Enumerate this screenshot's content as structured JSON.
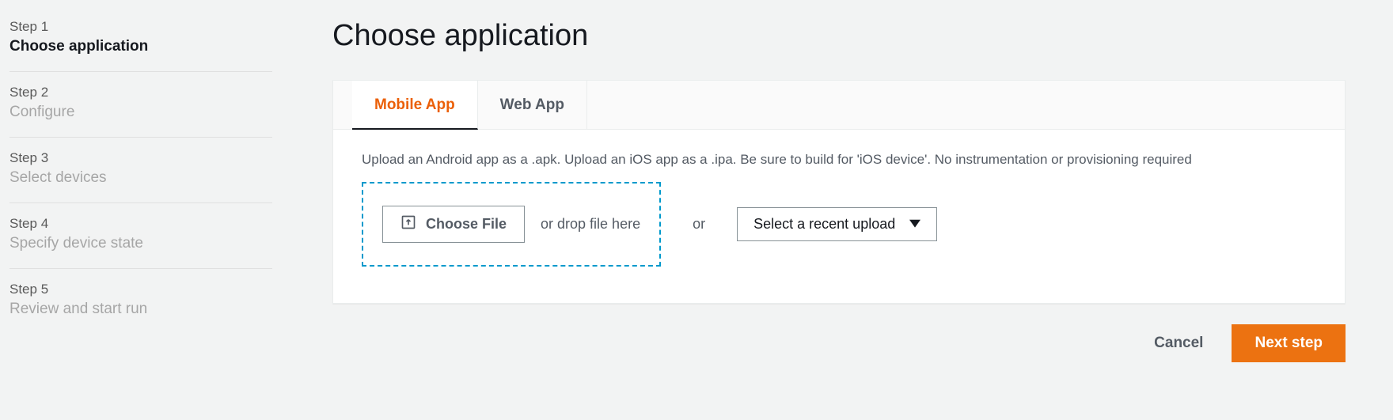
{
  "sidebar": {
    "steps": [
      {
        "label": "Step 1",
        "title": "Choose application",
        "active": true
      },
      {
        "label": "Step 2",
        "title": "Configure",
        "active": false
      },
      {
        "label": "Step 3",
        "title": "Select devices",
        "active": false
      },
      {
        "label": "Step 4",
        "title": "Specify device state",
        "active": false
      },
      {
        "label": "Step 5",
        "title": "Review and start run",
        "active": false
      }
    ]
  },
  "main": {
    "title": "Choose application",
    "tabs": [
      {
        "label": "Mobile App",
        "active": true
      },
      {
        "label": "Web App",
        "active": false
      }
    ],
    "help_text": "Upload an Android app as a .apk. Upload an iOS app as a .ipa. Be sure to build for 'iOS device'. No instrumentation or provisioning required",
    "choose_file_label": "Choose File",
    "drop_text": "or drop file here",
    "or_text": "or",
    "select_label": "Select a recent upload",
    "cancel_label": "Cancel",
    "next_label": "Next step"
  }
}
